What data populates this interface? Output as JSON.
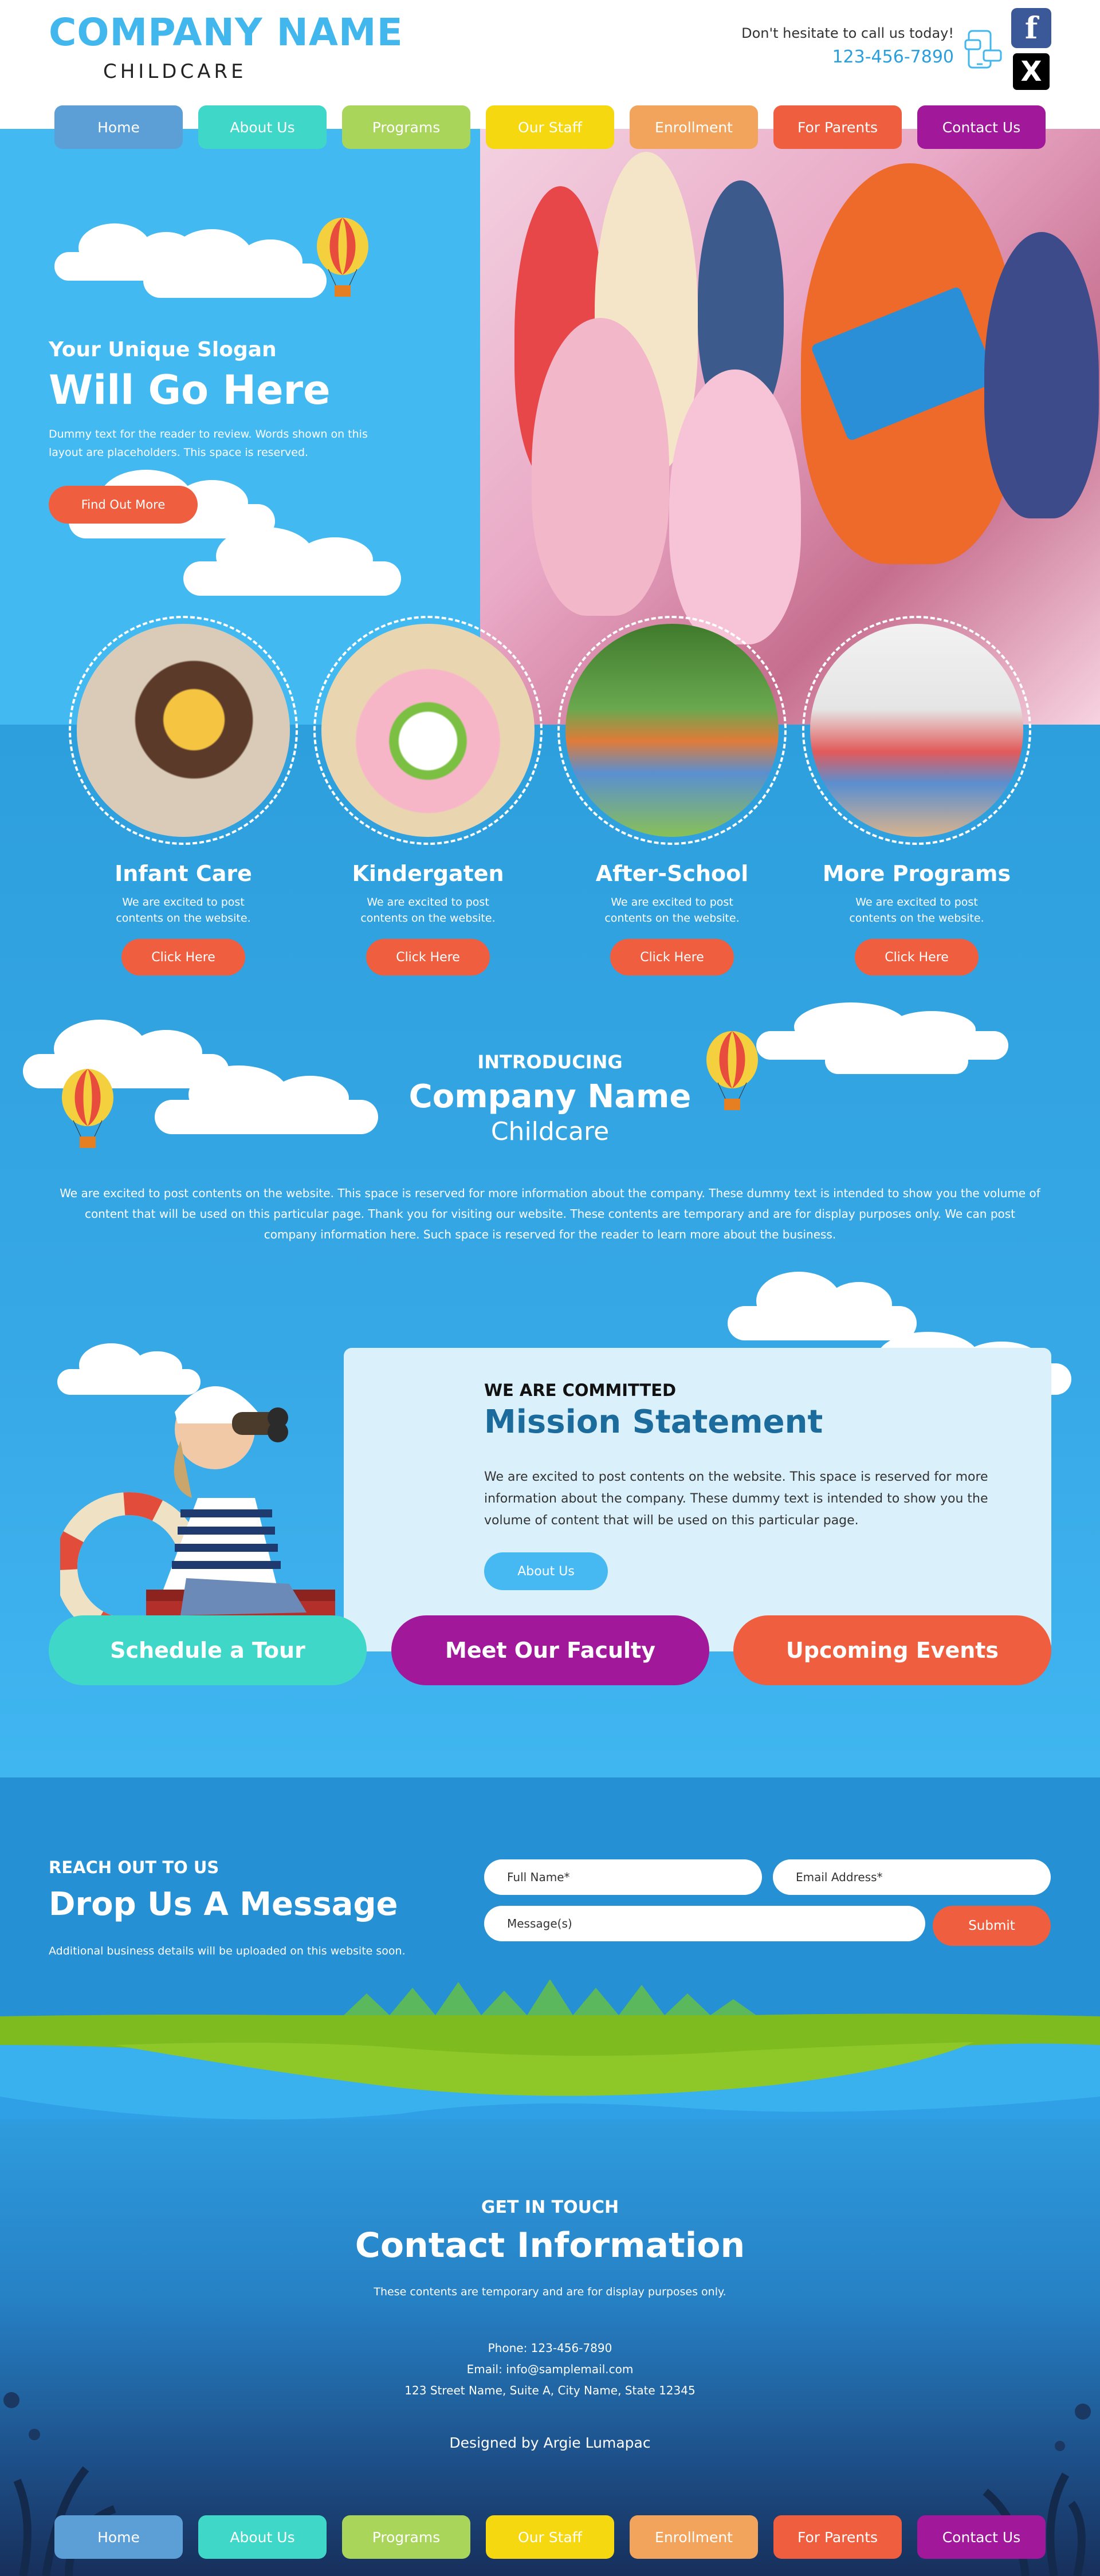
{
  "header": {
    "company_name": "COMPANY NAME",
    "company_sub": "CHILDCARE",
    "call_text": "Don't hesitate to call us today!",
    "phone": "123-456-7890"
  },
  "social": {
    "facebook": "f",
    "twitter": "X"
  },
  "nav": {
    "items": [
      {
        "label": "Home",
        "color": "#5b9fd6"
      },
      {
        "label": "About Us",
        "color": "#3fd8c8"
      },
      {
        "label": "Programs",
        "color": "#a9d65a"
      },
      {
        "label": "Our Staff",
        "color": "#f5d80f"
      },
      {
        "label": "Enrollment",
        "color": "#f2a45c"
      },
      {
        "label": "For Parents",
        "color": "#ef5e3e"
      },
      {
        "label": "Contact Us",
        "color": "#a1189b"
      }
    ]
  },
  "hero": {
    "slogan_small": "Your Unique Slogan",
    "slogan_big": "Will Go Here",
    "description": "Dummy text for the reader to review. Words shown on this layout are placeholders. This space is reserved.",
    "button": "Find Out More"
  },
  "services": [
    {
      "title": "Infant Care",
      "desc": "We are excited to post contents on the website.",
      "button": "Click Here"
    },
    {
      "title": "Kindergaten",
      "desc": "We are excited to post contents on the website.",
      "button": "Click Here"
    },
    {
      "title": "After-School",
      "desc": "We are excited to post contents on the website.",
      "button": "Click Here"
    },
    {
      "title": "More Programs",
      "desc": "We are excited to post contents on the website.",
      "button": "Click Here"
    }
  ],
  "intro": {
    "label": "INTRODUCING",
    "title": "Company Name",
    "subtitle": "Childcare",
    "description": "We are excited to post contents on the website. This space is reserved for more information about the company. These dummy text is intended to show you the volume of content that will be used on this particular page. Thank you for visiting our website. These contents are temporary and are for display purposes only. We can post company information here. Such space is reserved for the reader to learn more about the business."
  },
  "mission": {
    "label": "WE ARE COMMITTED",
    "title": "Mission Statement",
    "description": "We are excited to post contents on the website. This space is reserved for more information about the company. These dummy text is intended to show you the volume of content that will be used on this particular page.",
    "button": "About Us"
  },
  "cta": [
    {
      "label": "Schedule a Tour",
      "color": "#3fd8c8"
    },
    {
      "label": "Meet Our Faculty",
      "color": "#a1189b"
    },
    {
      "label": "Upcoming Events",
      "color": "#ef5e3e"
    }
  ],
  "message": {
    "label": "REACH OUT TO US",
    "title": "Drop Us A Message",
    "info": "Additional business details will be uploaded on this website soon.",
    "name_placeholder": "Full Name*",
    "email_placeholder": "Email Address*",
    "message_placeholder": "Message(s)",
    "submit": "Submit"
  },
  "contact": {
    "label": "GET IN TOUCH",
    "title": "Contact Information",
    "description": "These contents are temporary and are for display purposes only.",
    "phone": "Phone: 123-456-7890",
    "email": "Email: info@samplemail.com",
    "address": "123 Street Name, Suite A, City Name, State 12345",
    "designed_by": "Designed by Argie Lumapac"
  }
}
